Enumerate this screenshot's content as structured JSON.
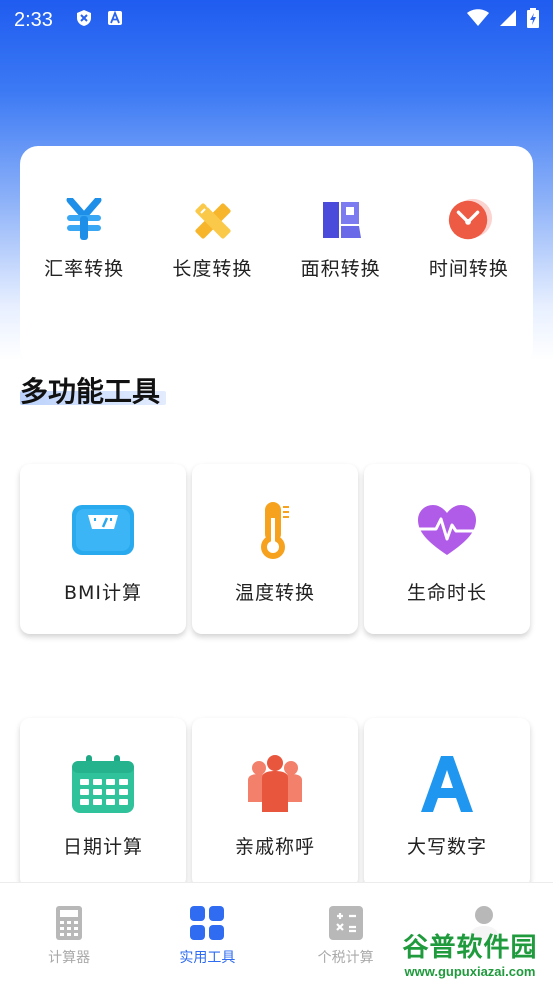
{
  "status_bar": {
    "time": "2:33",
    "icons": [
      "shield-icon",
      "a-icon",
      "wifi-icon",
      "signal-icon",
      "battery-icon"
    ]
  },
  "converters": [
    {
      "label": "汇率转换",
      "icon": "yen-icon"
    },
    {
      "label": "长度转换",
      "icon": "ruler-pencil-icon"
    },
    {
      "label": "面积转换",
      "icon": "area-icon"
    },
    {
      "label": "时间转换",
      "icon": "clock-icon"
    }
  ],
  "section": {
    "title": "多功能工具"
  },
  "tools": [
    {
      "label": "BMI计算",
      "icon": "scale-icon"
    },
    {
      "label": "温度转换",
      "icon": "thermometer-icon"
    },
    {
      "label": "生命时长",
      "icon": "heart-pulse-icon"
    },
    {
      "label": "日期计算",
      "icon": "calendar-icon"
    },
    {
      "label": "亲戚称呼",
      "icon": "people-icon"
    },
    {
      "label": "大写数字",
      "icon": "letter-a-icon"
    }
  ],
  "bottom_nav": [
    {
      "label": "计算器",
      "icon": "calculator-icon",
      "active": false
    },
    {
      "label": "实用工具",
      "icon": "grid-icon",
      "active": true
    },
    {
      "label": "个税计算",
      "icon": "tax-icon",
      "active": false
    },
    {
      "label": "",
      "icon": "profile-icon",
      "active": false
    }
  ],
  "watermark": {
    "title": "谷普软件园",
    "url": "www.gupuxiazai.com"
  },
  "colors": {
    "accent": "#2f6cf2",
    "inactive": "#aaaaaa"
  }
}
